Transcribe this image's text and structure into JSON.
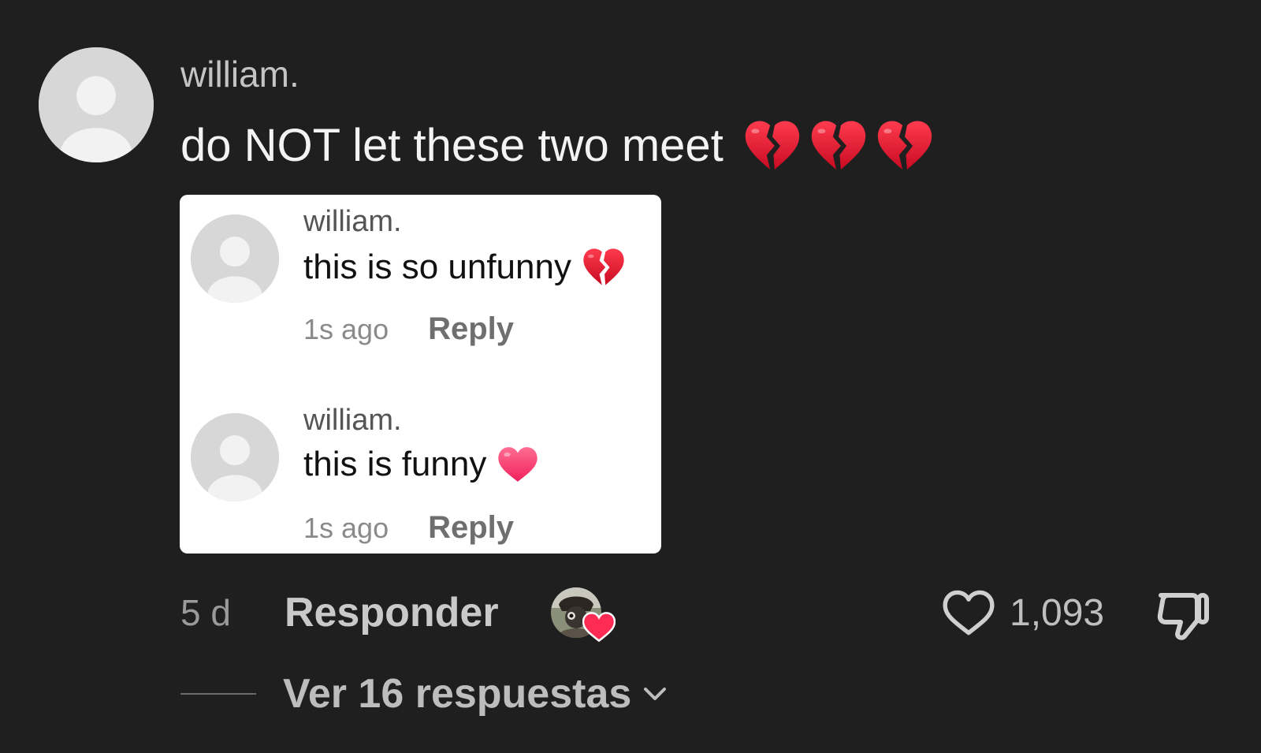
{
  "comment": {
    "username": "william.",
    "text": "do NOT let these two meet",
    "emoji_names": [
      "broken-heart-emoji",
      "broken-heart-emoji",
      "broken-heart-emoji"
    ],
    "time_ago": "5 d",
    "reply_label": "Responder",
    "like_count": "1,093",
    "view_replies_label": "Ver 16 respuestas"
  },
  "embedded_comments": [
    {
      "username": "william.",
      "text": "this is so unfunny",
      "emoji": "broken-heart-emoji",
      "time": "1s ago",
      "reply_label": "Reply"
    },
    {
      "username": "william.",
      "text": "this is funny",
      "emoji": "red-heart-emoji",
      "time": "1s ago",
      "reply_label": "Reply"
    }
  ],
  "colors": {
    "background": "#1f1f1f",
    "heart_red": "#fe2c55",
    "broken_heart_red": "#e3102c"
  }
}
